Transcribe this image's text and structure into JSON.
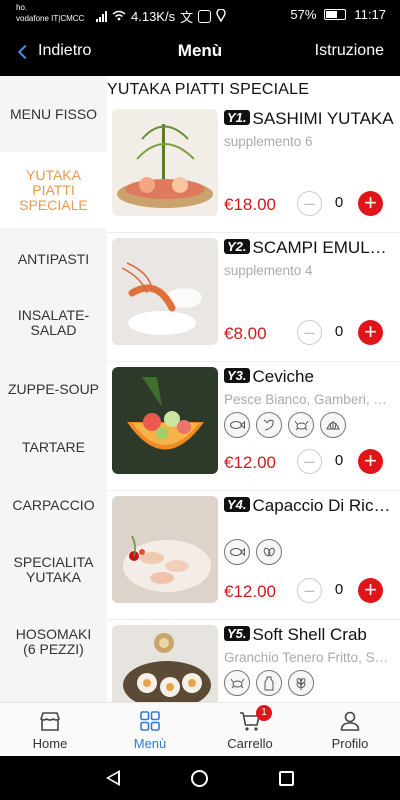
{
  "status_bar": {
    "carrier_line1": "ho.",
    "carrier_line2": "vodafone IT|CMCC",
    "speed": "4.13K/s",
    "battery": "57%",
    "time": "11:17"
  },
  "header": {
    "back_label": "Indietro",
    "title": "Menù",
    "right_label": "Istruzione"
  },
  "sidebar": {
    "items": [
      {
        "label": "MENU FISSO"
      },
      {
        "label": "YUTAKA PIATTI SPECIALE"
      },
      {
        "label": "ANTIPASTI"
      },
      {
        "label": "INSALATE-SALAD"
      },
      {
        "label": "ZUPPE-SOUP"
      },
      {
        "label": "TARTARE"
      },
      {
        "label": "CARPACCIO"
      },
      {
        "label": "SPECIALITA YUTAKA"
      },
      {
        "label": "HOSOMAKI (6 PEZZI)"
      }
    ]
  },
  "main": {
    "section_title": "YUTAKA PIATTI SPECIALE",
    "dishes": [
      {
        "code": "Y1.",
        "name": "SASHIMI YUTAKA",
        "subtitle": "supplemento 6",
        "price": "€18.00",
        "qty": "0",
        "tags": []
      },
      {
        "code": "Y2.",
        "name": "SCAMPI EMULSIONE",
        "subtitle": "supplemento 4",
        "price": "€8.00",
        "qty": "0",
        "tags": []
      },
      {
        "code": "Y3.",
        "name": "Ceviche",
        "subtitle": "Pesce Bianco, Gamberi, Cipolla Rossa",
        "price": "€12.00",
        "qty": "0",
        "tags": [
          "fish-icon",
          "shrimp-icon",
          "crab-icon",
          "shell-icon"
        ]
      },
      {
        "code": "Y4.",
        "name": "Capaccio Di Ricciola",
        "subtitle": "",
        "price": "€12.00",
        "qty": "0",
        "tags": [
          "fish-icon",
          "sesame-icon"
        ]
      },
      {
        "code": "Y5.",
        "name": "Soft Shell Crab",
        "subtitle": "Granchio Tenero Fritto, Salsa",
        "price": "",
        "qty": "",
        "tags": [
          "crab-icon",
          "milk-icon",
          "wheat-icon"
        ]
      }
    ]
  },
  "bottom_nav": {
    "items": [
      {
        "label": "Home"
      },
      {
        "label": "Menù"
      },
      {
        "label": "Carrello"
      },
      {
        "label": "Profilo"
      }
    ],
    "cart_count": "1"
  },
  "colors": {
    "accent_blue": "#2e7bd6",
    "sidebar_active": "#e89a4e",
    "price_red": "#d01919",
    "plus_red": "#e0151b"
  }
}
